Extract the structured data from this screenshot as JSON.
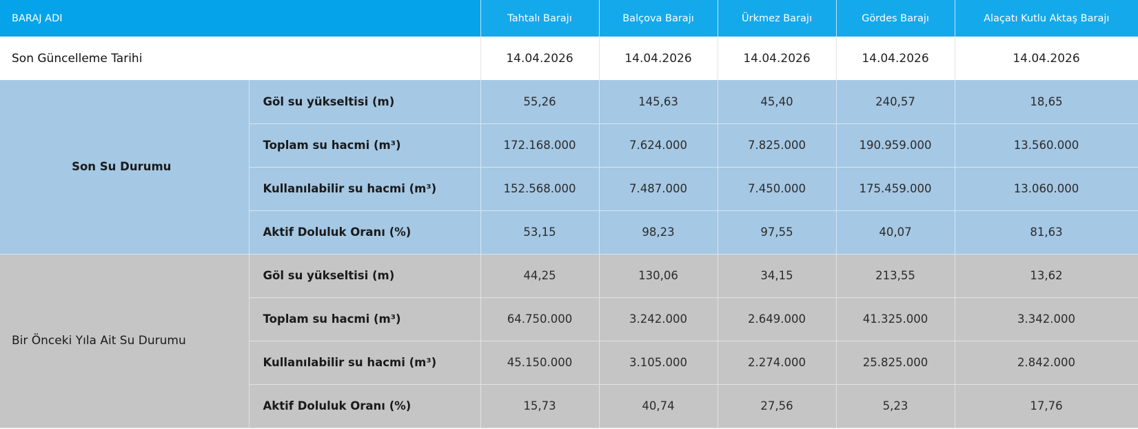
{
  "header": {
    "label": "BARAJ ADI",
    "dams": [
      "Tahtalı Barajı",
      "Balçova Barajı",
      "Ürkmez Barajı",
      "Gördes Barajı",
      "Alaçatı Kutlu Aktaş Barajı"
    ]
  },
  "last_update": {
    "label": "Son Güncelleme Tarihi",
    "values": [
      "14.04.2026",
      "14.04.2026",
      "14.04.2026",
      "14.04.2026",
      "14.04.2026"
    ]
  },
  "sections": [
    {
      "title": "Son Su Durumu",
      "rows": [
        {
          "label": "Göl su yükseltisi (m)",
          "values": [
            "55,26",
            "145,63",
            "45,40",
            "240,57",
            "18,65"
          ]
        },
        {
          "label": "Toplam su hacmi (m³)",
          "values": [
            "172.168.000",
            "7.624.000",
            "7.825.000",
            "190.959.000",
            "13.560.000"
          ]
        },
        {
          "label": "Kullanılabilir su hacmi (m³)",
          "values": [
            "152.568.000",
            "7.487.000",
            "7.450.000",
            "175.459.000",
            "13.060.000"
          ]
        },
        {
          "label": "Aktif Doluluk Oranı (%)",
          "values": [
            "53,15",
            "98,23",
            "97,55",
            "40,07",
            "81,63"
          ]
        }
      ]
    },
    {
      "title": "Bir Önceki Yıla Ait Su Durumu",
      "rows": [
        {
          "label": "Göl su yükseltisi (m)",
          "values": [
            "44,25",
            "130,06",
            "34,15",
            "213,55",
            "13,62"
          ]
        },
        {
          "label": "Toplam su hacmi (m³)",
          "values": [
            "64.750.000",
            "3.242.000",
            "2.649.000",
            "41.325.000",
            "3.342.000"
          ]
        },
        {
          "label": "Kullanılabilir su hacmi (m³)",
          "values": [
            "45.150.000",
            "3.105.000",
            "2.274.000",
            "25.825.000",
            "2.842.000"
          ]
        },
        {
          "label": "Aktif Doluluk Oranı (%)",
          "values": [
            "15,73",
            "40,74",
            "27,56",
            "5,23",
            "17,76"
          ]
        }
      ]
    }
  ],
  "colors": {
    "header_bg": "#14a9eb",
    "current_bg": "#a5c8e4",
    "previous_bg": "#c5c5c5"
  }
}
